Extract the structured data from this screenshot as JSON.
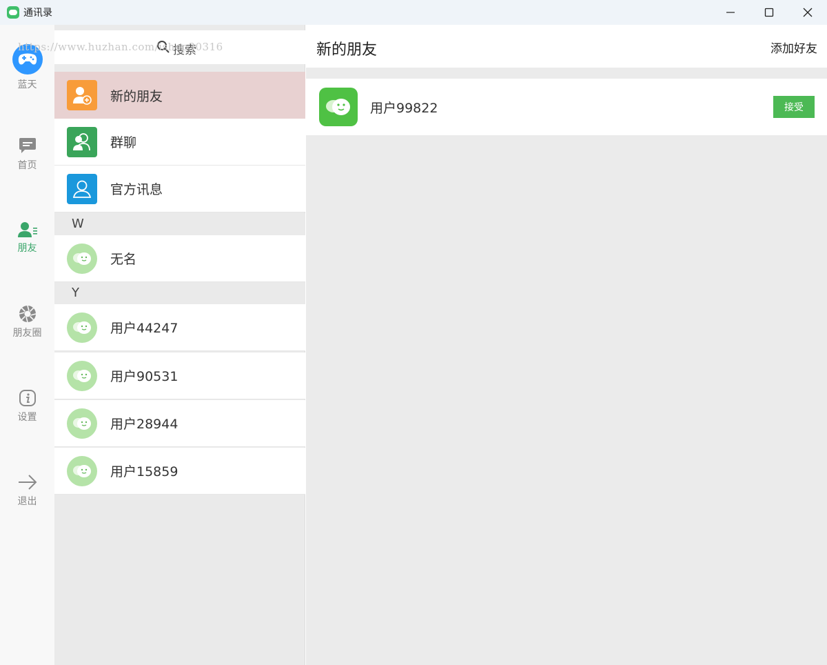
{
  "window": {
    "title": "通讯录",
    "accent": "#3aa66a"
  },
  "nav": {
    "items": [
      {
        "label": "蓝天",
        "icon": "gamepad-icon"
      },
      {
        "label": "首页",
        "icon": "chat-icon"
      },
      {
        "label": "朋友",
        "icon": "contacts-icon",
        "active": true
      },
      {
        "label": "朋友圈",
        "icon": "aperture-icon"
      },
      {
        "label": "设置",
        "icon": "info-icon"
      },
      {
        "label": "退出",
        "icon": "arrow-right-icon"
      }
    ]
  },
  "search": {
    "placeholder": "搜索",
    "watermark": "https://www.huzhan.com/ishop30316"
  },
  "contacts": {
    "top_items": [
      {
        "label": "新的朋友",
        "icon": "add-user-icon",
        "color": "#f89c3a",
        "selected": true
      },
      {
        "label": "群聊",
        "icon": "group-icon",
        "color": "#3aa55a"
      },
      {
        "label": "官方讯息",
        "icon": "user-outline-icon",
        "color": "#1a98dc"
      }
    ],
    "sections": [
      {
        "letter": "W",
        "items": [
          "无名"
        ]
      },
      {
        "letter": "Y",
        "items": [
          "用户44247",
          "用户90531",
          "用户28944",
          "用户15859"
        ]
      }
    ]
  },
  "detail": {
    "title": "新的朋友",
    "add_friend_label": "添加好友",
    "requests": [
      {
        "name": "用户99822",
        "accept_label": "接受"
      }
    ]
  }
}
